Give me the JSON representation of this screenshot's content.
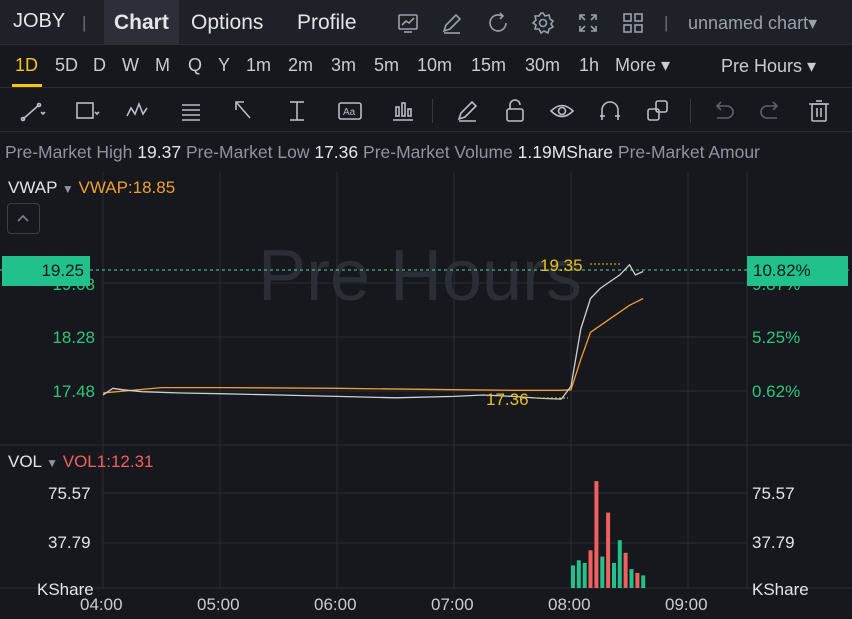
{
  "header": {
    "ticker": "JOBY",
    "separator": "|",
    "tabs": [
      {
        "label": "Chart"
      },
      {
        "label": "Options"
      },
      {
        "label": "Profile"
      }
    ],
    "chart_name": "unnamed chart▾"
  },
  "timeframes": {
    "items": [
      "1D",
      "5D",
      "D",
      "W",
      "M",
      "Q",
      "Y",
      "1m",
      "2m",
      "3m",
      "5m",
      "10m",
      "15m",
      "30m",
      "1h"
    ],
    "more_label": "More ▾",
    "session_label": "Pre Hours ▾",
    "active": "1D"
  },
  "info": {
    "high_label": "Pre-Market High",
    "high_value": "19.37",
    "low_label": "Pre-Market Low",
    "low_value": "17.36",
    "volume_label": "Pre-Market Volume",
    "volume_value": "1.19MShare",
    "amount_label": "Pre-Market Amour"
  },
  "price_panel": {
    "indicator": "VWAP",
    "indicator_value": "VWAP:18.85",
    "watermark": "Pre Hours",
    "current_price": "19.25",
    "current_pct": "10.82%",
    "left_ticks": [
      "19.08",
      "18.28",
      "17.48"
    ],
    "right_ticks": [
      "9.87%",
      "5.25%",
      "0.62%"
    ],
    "high_marker": "19.35",
    "low_marker": "17.36"
  },
  "volume_panel": {
    "indicator": "VOL",
    "indicator_value": "VOL1:12.31",
    "left_ticks": [
      "75.57",
      "37.79",
      "KShare"
    ],
    "right_ticks": [
      "75.57",
      "37.79",
      "KShare"
    ]
  },
  "time_axis": [
    "04:00",
    "05:00",
    "06:00",
    "07:00",
    "08:00",
    "09:00"
  ],
  "colors": {
    "accent": "#f5c518",
    "up": "#22c08a",
    "down": "#f06060",
    "vwap": "#f0a030",
    "price_line": "#d0d0d0"
  },
  "chart_data": {
    "type": "line",
    "x_range": [
      "04:00",
      "09:30"
    ],
    "price_ylim": [
      17.2,
      19.5
    ],
    "series": [
      {
        "name": "Price",
        "x": [
          "04:00",
          "04:05",
          "04:10",
          "04:20",
          "04:40",
          "05:00",
          "05:30",
          "06:00",
          "06:30",
          "07:00",
          "07:15",
          "07:30",
          "07:45",
          "07:55",
          "08:00",
          "08:05",
          "08:10",
          "08:15",
          "08:20",
          "08:25",
          "08:30",
          "08:33",
          "08:37"
        ],
        "values": [
          17.42,
          17.52,
          17.5,
          17.47,
          17.45,
          17.44,
          17.42,
          17.4,
          17.38,
          17.4,
          17.42,
          17.4,
          17.37,
          17.36,
          17.55,
          18.4,
          18.85,
          19.0,
          19.1,
          19.2,
          19.35,
          19.2,
          19.25
        ]
      },
      {
        "name": "VWAP",
        "x": [
          "04:00",
          "04:30",
          "05:00",
          "06:00",
          "07:00",
          "07:30",
          "07:55",
          "08:00",
          "08:05",
          "08:10",
          "08:20",
          "08:30",
          "08:37"
        ],
        "values": [
          17.45,
          17.53,
          17.53,
          17.52,
          17.5,
          17.49,
          17.49,
          17.5,
          17.95,
          18.35,
          18.55,
          18.75,
          18.85
        ]
      }
    ],
    "volume": {
      "ylim": [
        0,
        90
      ],
      "x": [
        "08:00",
        "08:03",
        "08:06",
        "08:09",
        "08:12",
        "08:15",
        "08:18",
        "08:21",
        "08:24",
        "08:27",
        "08:30",
        "08:33",
        "08:36"
      ],
      "values": [
        18,
        22,
        20,
        30,
        85,
        25,
        60,
        20,
        38,
        28,
        15,
        12,
        10
      ],
      "up_down": [
        "up",
        "up",
        "up",
        "down",
        "down",
        "up",
        "down",
        "up",
        "up",
        "down",
        "up",
        "down",
        "up"
      ]
    }
  }
}
